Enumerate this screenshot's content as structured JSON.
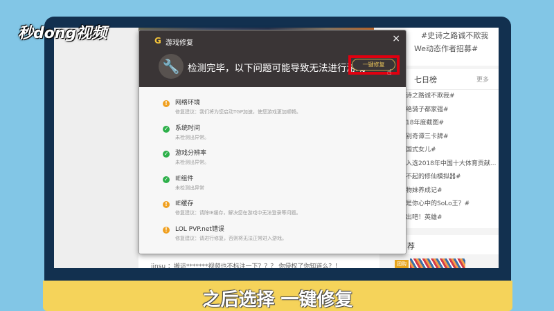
{
  "logo": "秒dong视频",
  "dialog": {
    "title": "游戏修复",
    "message": "检测完毕，以下问题可能导致无法进行游戏",
    "fix_button": "一键修复",
    "close": "×",
    "items": [
      {
        "name": "网络环境",
        "desc": "修复建议：我们将为您启动TGP加速，使您游戏更加顺畅。",
        "status": "warn"
      },
      {
        "name": "系统时间",
        "desc": "未检测出异常。",
        "status": "ok"
      },
      {
        "name": "游戏分辨率",
        "desc": "未检测出异常。",
        "status": "ok"
      },
      {
        "name": "IE组件",
        "desc": "未检测出异常",
        "status": "ok"
      },
      {
        "name": "IE缓存",
        "desc": "修复建议：请除IE缓存，解决您在游戏中无法登录等问题。",
        "status": "warn"
      },
      {
        "name": "LOL PVP.net错误",
        "desc": "修复建议：请进行修复，否则将无法正常进入游戏。",
        "status": "warn"
      }
    ]
  },
  "right": {
    "tag1": "#史诗之路诚不欺我",
    "tag2": "We动态作者招募#",
    "rank_title": "七日榜",
    "more": "更多",
    "rank": [
      "诗之路诚不欺我#",
      "绝骑子都家强#",
      "18年度截图#",
      "别奇谭三卡牌#",
      "国式女儿#",
      "入选2018年中国十大体育贡献...",
      "不起的修仙模拟器#",
      "物妹养成记#",
      "是你心中的SoLo王？#",
      "出吧！英雄#"
    ],
    "recommend": "荐",
    "badge": "团购"
  },
  "comment": "jinsu ：搬运*******视频也不标注一下？？？ 你侵权了你知道么？！",
  "subtitle": "之后选择 一键修复"
}
